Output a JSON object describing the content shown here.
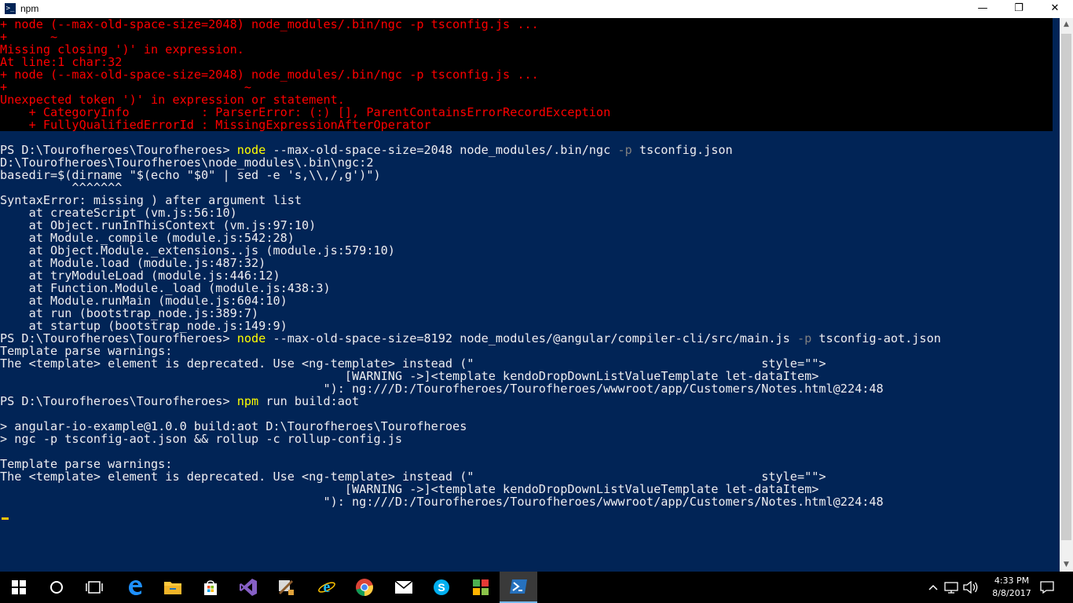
{
  "window": {
    "title": "npm",
    "minimize_glyph": "—",
    "maximize_glyph": "❐",
    "close_glyph": "✕"
  },
  "terminal": {
    "err_lines": [
      "+ node (--max-old-space-size=2048) node_modules/.bin/ngc -p tsconfig.js ...",
      "+      ~",
      "Missing closing ')' in expression.",
      "At line:1 char:32",
      "+ node (--max-old-space-size=2048) node_modules/.bin/ngc -p tsconfig.js ...",
      "+                                 ~",
      "Unexpected token ')' in expression or statement.",
      "    + CategoryInfo          : ParserError: (:) [], ParentContainsErrorRecordException",
      "    + FullyQualifiedErrorId : MissingExpressionAfterOperator"
    ],
    "cmd1": {
      "prompt": "PS D:\\Tourofheroes\\Tourofheroes> ",
      "cmd": "node",
      "args1": " --max-old-space-size=2048 node_modules/.bin/ngc ",
      "param": "-p",
      "args2": " tsconfig.json"
    },
    "out1": [
      "D:\\Tourofheroes\\Tourofheroes\\node_modules\\.bin\\ngc:2",
      "basedir=$(dirname \"$(echo \"$0\" | sed -e 's,\\\\,/,g')\")",
      "          ^^^^^^^",
      "SyntaxError: missing ) after argument list",
      "    at createScript (vm.js:56:10)",
      "    at Object.runInThisContext (vm.js:97:10)",
      "    at Module._compile (module.js:542:28)",
      "    at Object.Module._extensions..js (module.js:579:10)",
      "    at Module.load (module.js:487:32)",
      "    at tryModuleLoad (module.js:446:12)",
      "    at Function.Module._load (module.js:438:3)",
      "    at Module.runMain (module.js:604:10)",
      "    at run (bootstrap_node.js:389:7)",
      "    at startup (bootstrap_node.js:149:9)"
    ],
    "cmd2": {
      "prompt": "PS D:\\Tourofheroes\\Tourofheroes> ",
      "cmd": "node",
      "args1": " --max-old-space-size=8192 node_modules/@angular/compiler-cli/src/main.js ",
      "param": "-p",
      "args2": " tsconfig-aot.json"
    },
    "out2": [
      "Template parse warnings:",
      "The <template> element is deprecated. Use <ng-template> instead (\"                                        style=\"\">",
      "                                                [WARNING ->]<template kendoDropDownListValueTemplate let-dataItem>",
      "                                             \"): ng:///D:/Tourofheroes/Tourofheroes/wwwroot/app/Customers/Notes.html@224:48"
    ],
    "cmd3": {
      "prompt": "PS D:\\Tourofheroes\\Tourofheroes> ",
      "cmd": "npm",
      "args1": " run build:aot"
    },
    "out3": [
      "> angular-io-example@1.0.0 build:aot D:\\Tourofheroes\\Tourofheroes",
      "> ngc -p tsconfig-aot.json && rollup -c rollup-config.js"
    ],
    "out4": [
      "Template parse warnings:",
      "The <template> element is deprecated. Use <ng-template> instead (\"                                        style=\"\">",
      "                                                [WARNING ->]<template kendoDropDownListValueTemplate let-dataItem>",
      "                                             \"): ng:///D:/Tourofheroes/Tourofheroes/wwwroot/app/Customers/Notes.html@224:48"
    ]
  },
  "taskbar": {
    "items": [
      {
        "name": "start-button",
        "icon": "windows-logo-icon"
      },
      {
        "name": "cortana-button",
        "icon": "circle-search-icon"
      },
      {
        "name": "task-view-button",
        "icon": "task-view-icon"
      },
      {
        "name": "edge-taskbar-item",
        "icon": "edge-icon"
      },
      {
        "name": "file-explorer-taskbar-item",
        "icon": "folder-icon"
      },
      {
        "name": "store-taskbar-item",
        "icon": "store-bag-icon"
      },
      {
        "name": "visual-studio-taskbar-item",
        "icon": "visual-studio-icon"
      },
      {
        "name": "tools-taskbar-item",
        "icon": "tools-icon"
      },
      {
        "name": "ie-taskbar-item",
        "icon": "internet-explorer-icon"
      },
      {
        "name": "chrome-taskbar-item",
        "icon": "chrome-icon"
      },
      {
        "name": "mail-taskbar-item",
        "icon": "mail-icon"
      },
      {
        "name": "skype-taskbar-item",
        "icon": "skype-icon"
      },
      {
        "name": "app-taskbar-item",
        "icon": "grid-app-icon"
      },
      {
        "name": "powershell-taskbar-item",
        "icon": "powershell-icon"
      }
    ],
    "tray": {
      "time": "4:33 PM",
      "date": "8/8/2017"
    }
  },
  "colors": {
    "background": "#012456",
    "error_block": "#000000",
    "error_text": "#ff0000",
    "command": "#ffff00",
    "parameter": "#808080",
    "text": "#eeedf0",
    "cursor": "#ffc400"
  }
}
